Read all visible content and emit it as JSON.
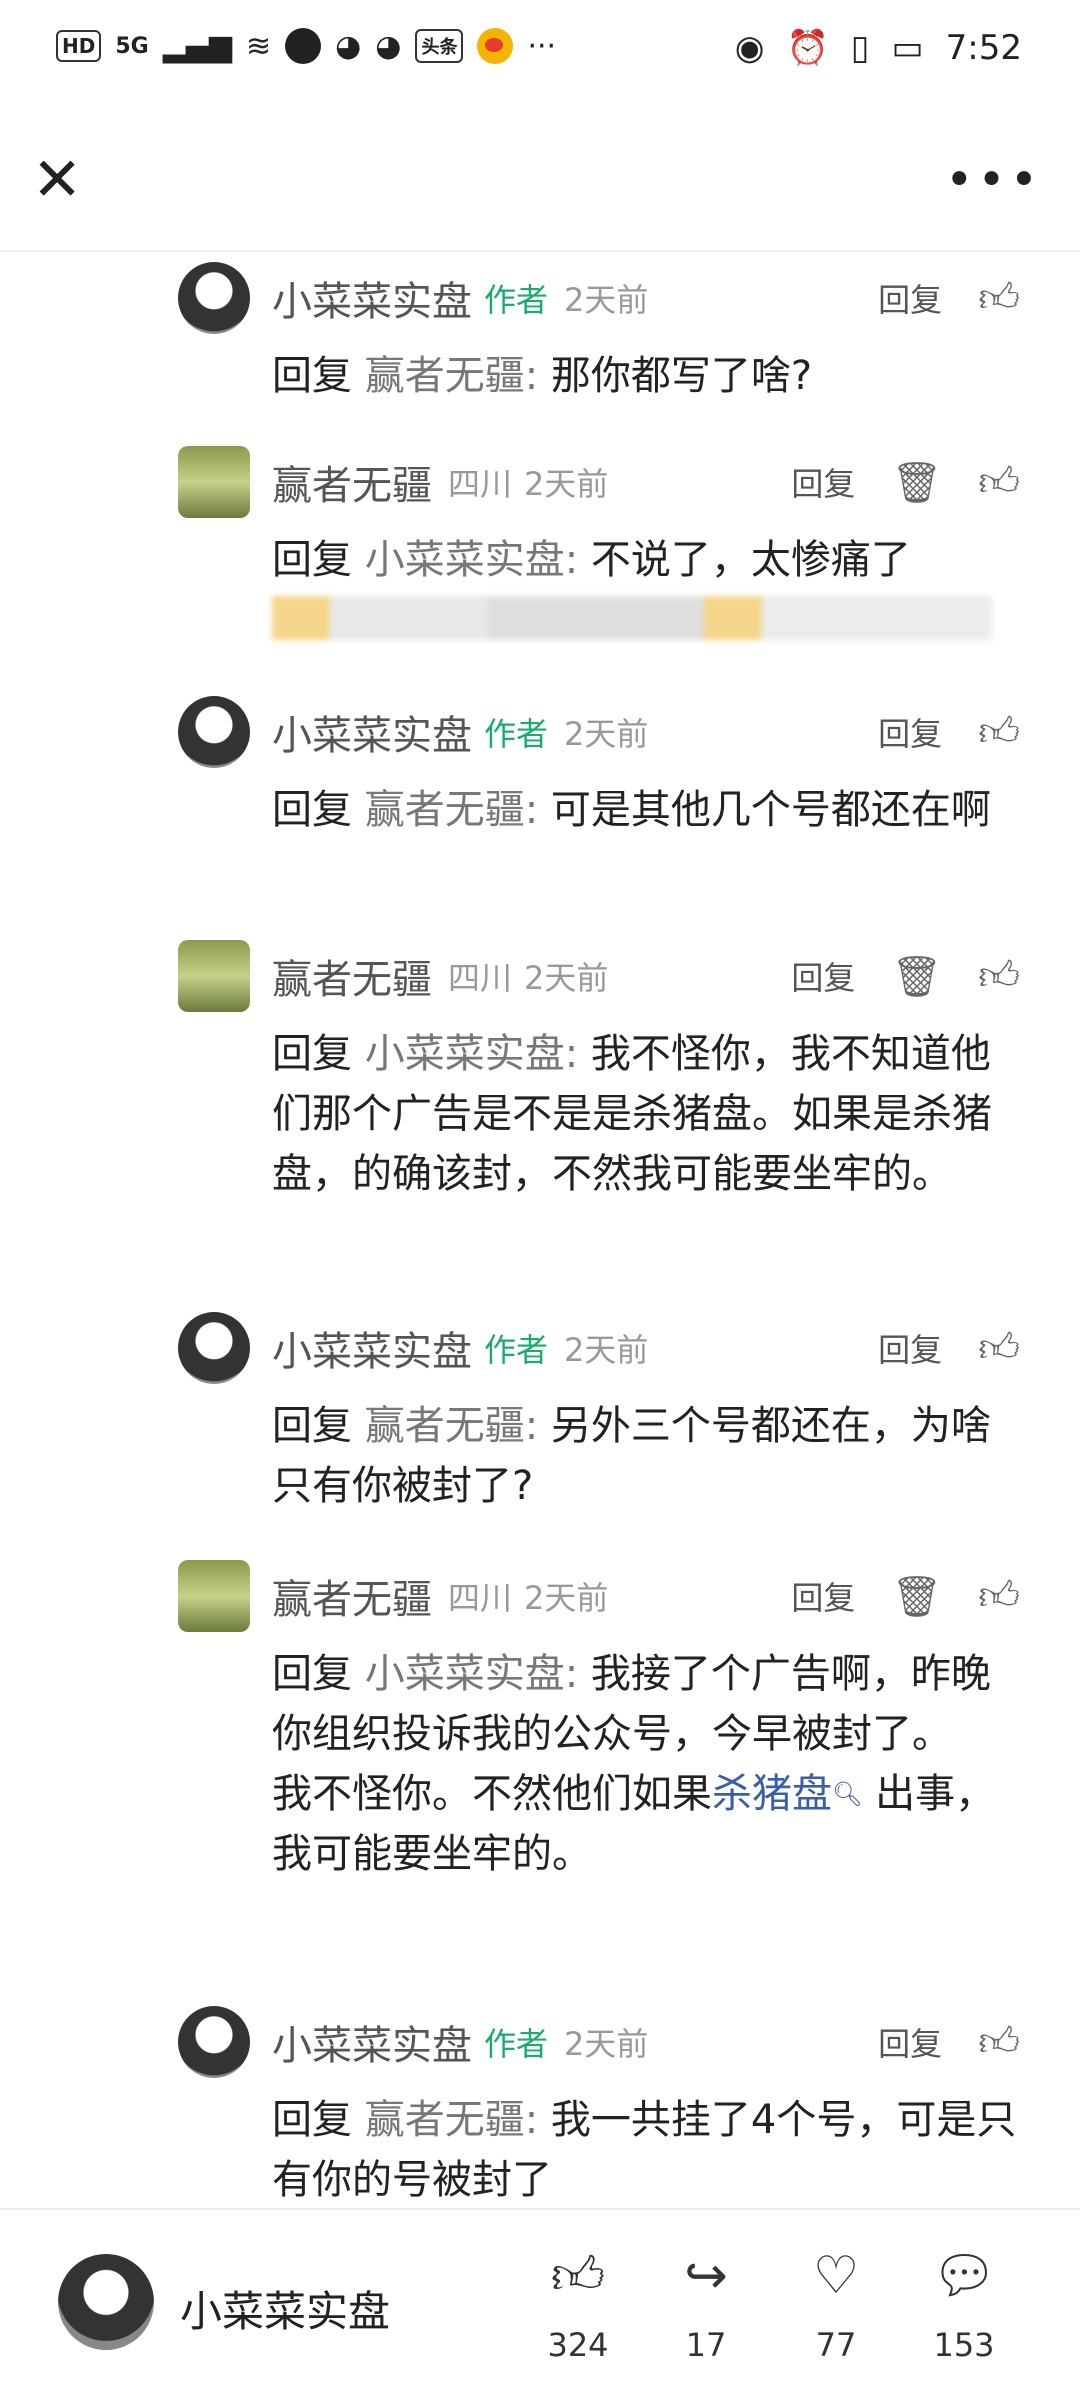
{
  "status": {
    "time": "7:52",
    "left_labels": [
      "HD",
      "5G"
    ],
    "news_badge": "头条"
  },
  "header": {
    "close_label": "✕",
    "more_label": "•••"
  },
  "comments": [
    {
      "user": "小菜菜实盘",
      "author": "作者",
      "loc": "",
      "time": "2天前",
      "reply": "回复",
      "delete": false,
      "reply_to": "赢者无疆:",
      "text": "那你都写了啥?"
    },
    {
      "user": "赢者无疆",
      "author": "",
      "loc": "四川",
      "time": "2天前",
      "reply": "回复",
      "delete": true,
      "reply_to": "小菜菜实盘:",
      "text": "不说了，太惨痛了"
    },
    {
      "user": "小菜菜实盘",
      "author": "作者",
      "loc": "",
      "time": "2天前",
      "reply": "回复",
      "delete": false,
      "reply_to": "赢者无疆:",
      "text": "可是其他几个号都还在啊"
    },
    {
      "user": "赢者无疆",
      "author": "",
      "loc": "四川",
      "time": "2天前",
      "reply": "回复",
      "delete": true,
      "reply_to": "小菜菜实盘:",
      "text": "我不怪你，我不知道他们那个广告是不是是杀猪盘。如果是杀猪盘，的确该封，不然我可能要坐牢的。"
    },
    {
      "user": "小菜菜实盘",
      "author": "作者",
      "loc": "",
      "time": "2天前",
      "reply": "回复",
      "delete": false,
      "reply_to": "赢者无疆:",
      "text": "另外三个号都还在，为啥只有你被封了?"
    },
    {
      "user": "赢者无疆",
      "author": "",
      "loc": "四川",
      "time": "2天前",
      "reply": "回复",
      "delete": true,
      "reply_to": "小菜菜实盘:",
      "text": "我接了个广告啊，昨晚你组织投诉我的公众号，今早被封了。",
      "text2_pre": "我不怪你。不然他们如果",
      "text2_link": "杀猪盘",
      "text2_post": " 出事，我可能要坐牢的。"
    },
    {
      "user": "小菜菜实盘",
      "author": "作者",
      "loc": "",
      "time": "2天前",
      "reply": "回复",
      "delete": false,
      "reply_to": "赢者无疆:",
      "text": "我一共挂了4个号，可是只有你的号被封了"
    }
  ],
  "bottom": {
    "name": "小菜菜实盘",
    "likes": "324",
    "shares": "17",
    "favorites": "77",
    "comments": "153"
  }
}
